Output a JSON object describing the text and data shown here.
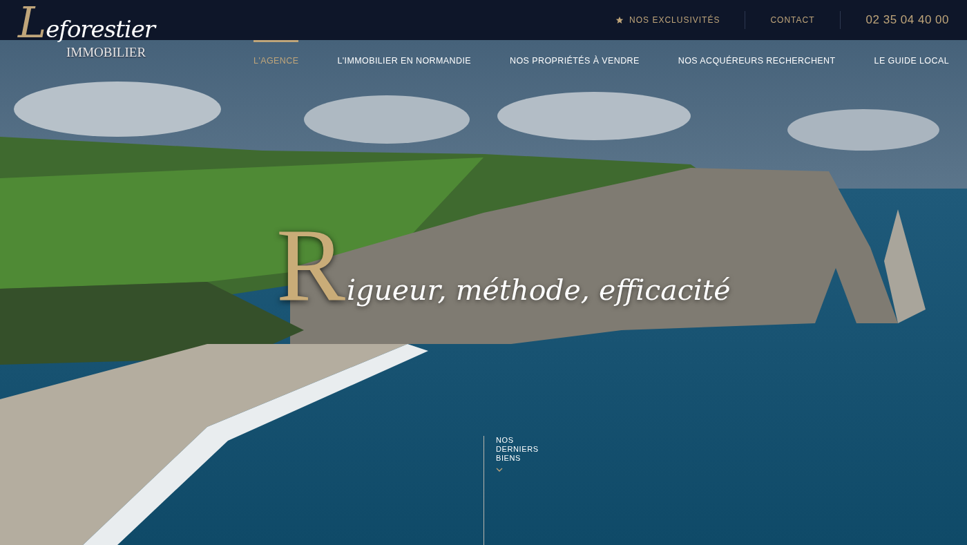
{
  "logo": {
    "name": "Leforestier",
    "tagline": "IMMOBILIER"
  },
  "top_links": [
    {
      "label": "NOS EXCLUSIVITÉS",
      "kind": "star"
    },
    {
      "label": "CONTACT",
      "kind": "plain"
    }
  ],
  "phone": "02 35 04 40 00",
  "nav": [
    {
      "label": "L'AGENCE",
      "selected": true
    },
    {
      "label": "L'IMMOBILIER EN NORMANDIE",
      "selected": false
    },
    {
      "label": "NOS PROPRIÉTÉS À VENDRE",
      "selected": false
    },
    {
      "label": "NOS ACQUÉREURS RECHERCHENT",
      "selected": false
    },
    {
      "label": "LE GUIDE LOCAL",
      "selected": false
    }
  ],
  "hero": {
    "headline": "Rigueur, méthode, efficacité"
  },
  "scroll_cue": {
    "label": "NOS DERNIERS BIENS"
  }
}
